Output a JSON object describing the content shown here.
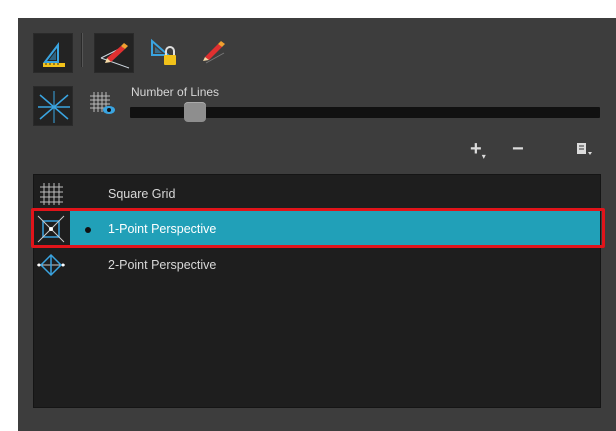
{
  "toolbar": {
    "tools": [
      {
        "name": "grid-tool-icon",
        "active": true
      },
      {
        "name": "perspective-pencil-icon",
        "active": true
      },
      {
        "name": "lock-guide-icon",
        "active": false
      },
      {
        "name": "align-pencil-icon",
        "active": false
      },
      {
        "name": "guide-lines-icon",
        "active": true
      }
    ]
  },
  "lines": {
    "label": "Number of Lines",
    "value": 0.12
  },
  "list_controls": {
    "add": "+",
    "remove": "−"
  },
  "guides": {
    "items": [
      {
        "label": "Square Grid",
        "selected": false
      },
      {
        "label": "1-Point Perspective",
        "selected": true
      },
      {
        "label": "2-Point Perspective",
        "selected": false
      }
    ]
  },
  "colors": {
    "panel_bg": "#3d3d3d",
    "list_bg": "#1e1e1e",
    "selection": "#21a0b8",
    "highlight": "#e1141a"
  }
}
